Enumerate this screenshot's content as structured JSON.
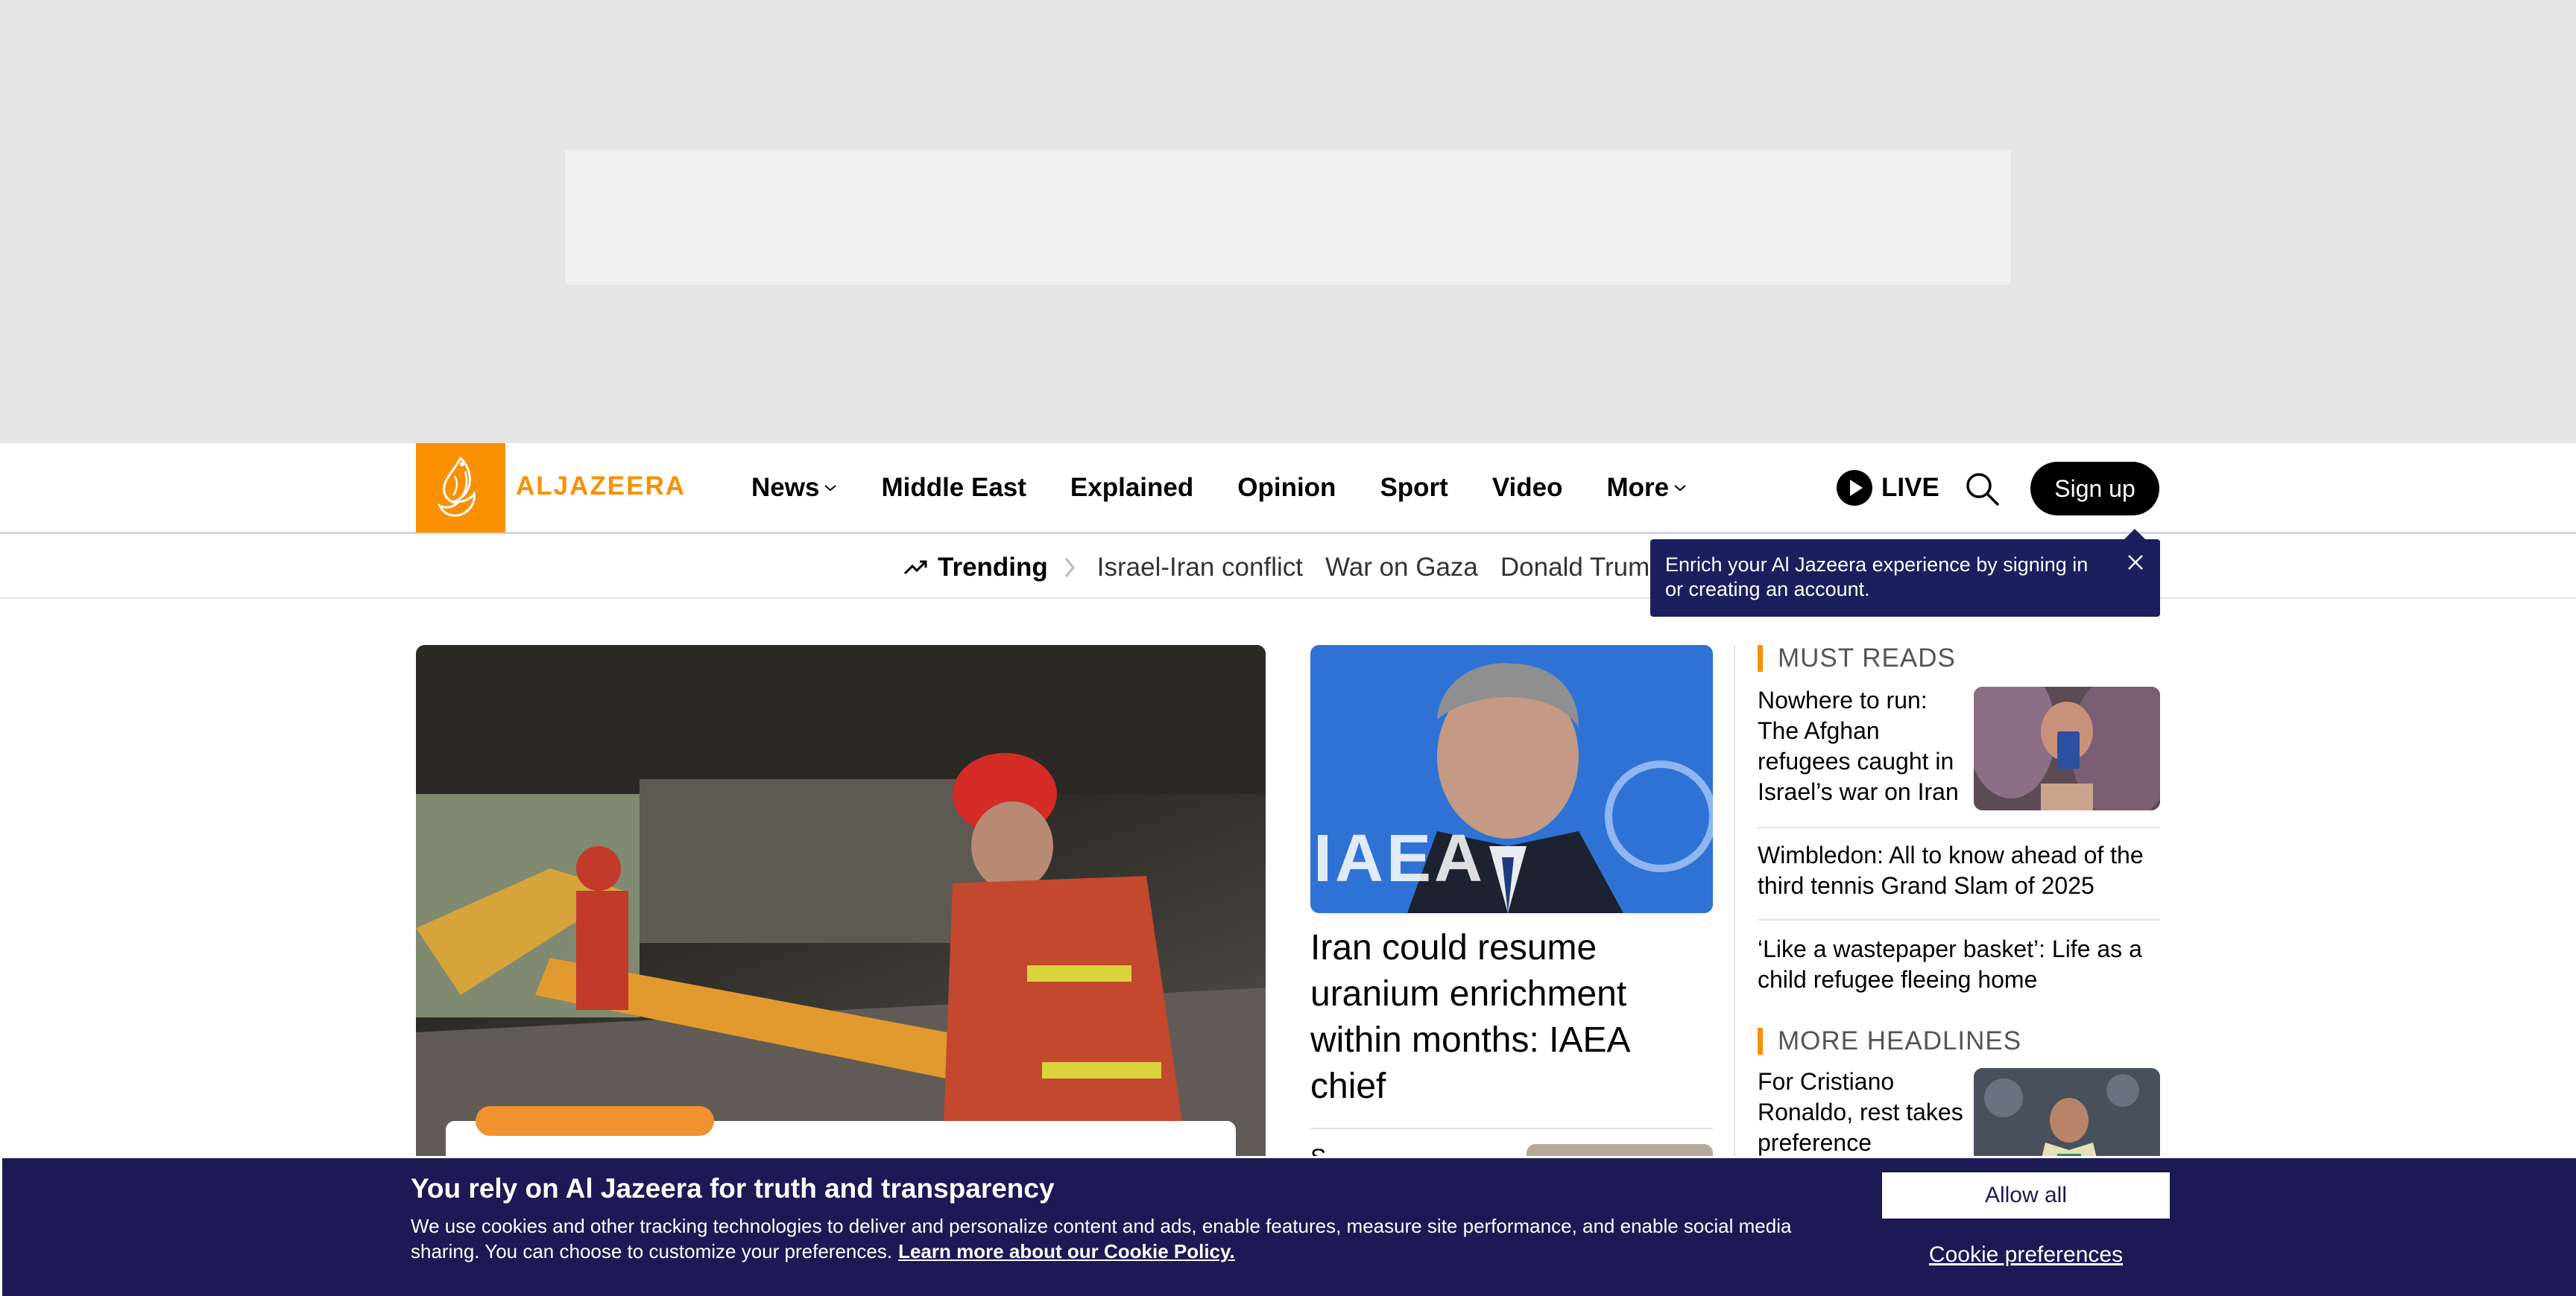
{
  "brand": {
    "name": "ALJAZEERA",
    "accent_color": "#fa9000",
    "navy_color": "#1b1a54"
  },
  "nav": {
    "items": [
      {
        "label": "News",
        "has_dropdown": true
      },
      {
        "label": "Middle East",
        "has_dropdown": false
      },
      {
        "label": "Explained",
        "has_dropdown": false
      },
      {
        "label": "Opinion",
        "has_dropdown": false
      },
      {
        "label": "Sport",
        "has_dropdown": false
      },
      {
        "label": "Video",
        "has_dropdown": false
      },
      {
        "label": "More",
        "has_dropdown": true
      }
    ],
    "live_label": "LIVE",
    "search_icon": "search-icon",
    "signup_label": "Sign up"
  },
  "trending": {
    "label": "Trending",
    "links": [
      "Israel-Iran conflict",
      "War on Gaza",
      "Donald Trum"
    ]
  },
  "tooltip": {
    "text": "Enrich your Al Jazeera experience by signing in or creating an account."
  },
  "main": {
    "second_story": {
      "title": "Iran could resume uranium enrichment within months: IAEA chief",
      "image_text": "IAEA"
    },
    "third_story_partial": "S"
  },
  "sidebar": {
    "must_reads_heading": "MUST READS",
    "must_reads": [
      {
        "title": "Nowhere to run: The Afghan refugees caught in Israel’s war on Iran",
        "has_image": true
      },
      {
        "title": "Wimbledon: All to know ahead of the third tennis Grand Slam of 2025",
        "has_image": false
      },
      {
        "title": "‘Like a wastepaper basket’: Life as a child refugee fleeing home",
        "has_image": false
      }
    ],
    "more_headlines_heading": "MORE HEADLINES",
    "more_headlines": [
      {
        "title": "For Cristiano Ronaldo, rest takes preference",
        "has_image": true
      }
    ]
  },
  "cookie_banner": {
    "title": "You rely on Al Jazeera for truth and transparency",
    "body": "We use cookies and other tracking technologies to deliver and personalize content and ads, enable features, measure site performance, and enable social media sharing. You can choose to customize your preferences.",
    "policy_link": "Learn more about our Cookie Policy.",
    "allow_all": "Allow all",
    "preferences": "Cookie preferences"
  }
}
